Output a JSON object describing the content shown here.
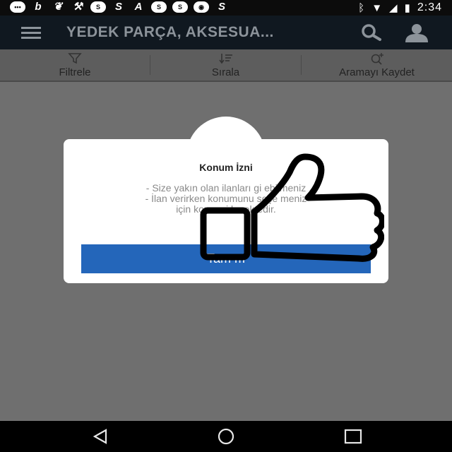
{
  "status_bar": {
    "left_icons": [
      "chat-bubble-icon",
      "b-icon",
      "bird-icon",
      "wrench-icon",
      "sahibinden-icon",
      "s-icon",
      "a-icon",
      "sahibinden-icon",
      "sahibinden-icon",
      "camera-icon",
      "s-icon"
    ],
    "b_glyph": "b",
    "s_glyph": "S",
    "a_glyph": "A",
    "right_icons": [
      "bluetooth-icon",
      "wifi-icon",
      "signal-icon",
      "battery-icon"
    ],
    "time": "2:34"
  },
  "app_bar": {
    "title": "YEDEK PARÇA, AKSESUA...",
    "icons": [
      "menu-icon",
      "search-icon",
      "user-icon"
    ]
  },
  "toolbar": {
    "filter_label": "Filtrele",
    "sort_label": "Sırala",
    "save_search_label": "Aramayı Kaydet"
  },
  "dialog": {
    "title": "Konum İzni",
    "message_lines": [
      "- Size yakın olan ilanları gi    ebilmeniz",
      "- İlan verirken konumunu    seçe    meniz",
      "için konum i         kmektedir."
    ],
    "ok_label": "Tam    m"
  },
  "overlay": {
    "icon": "thumbs-up-icon"
  },
  "nav_bar": {
    "icons": [
      "back-icon",
      "home-icon",
      "recents-icon"
    ]
  },
  "colors": {
    "appbar": "#101820",
    "button": "#2466ba",
    "backdrop": "#6f6f6f"
  }
}
